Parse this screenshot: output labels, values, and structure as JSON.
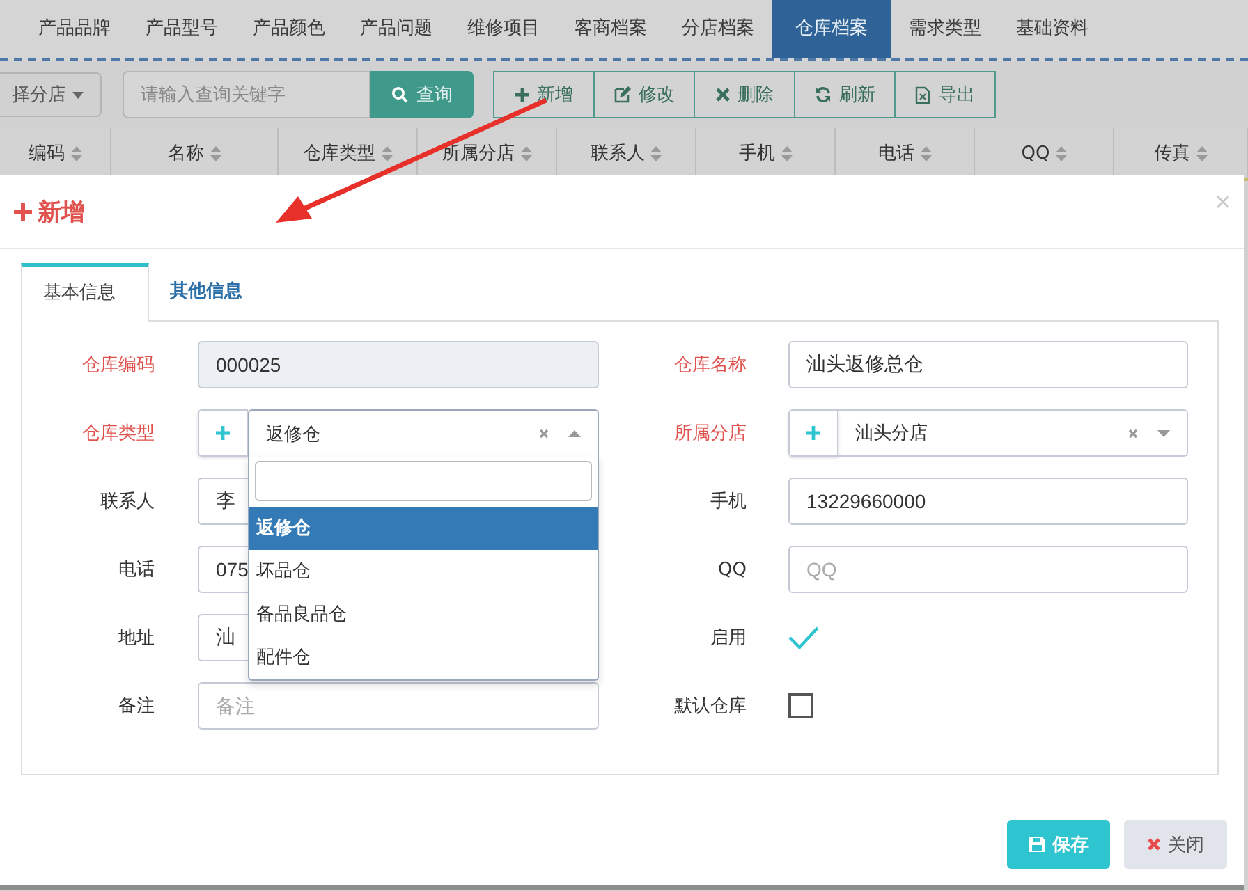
{
  "nav_tabs": [
    {
      "label": "产品品牌",
      "selected": false
    },
    {
      "label": "产品型号",
      "selected": false
    },
    {
      "label": "产品颜色",
      "selected": false
    },
    {
      "label": "产品问题",
      "selected": false
    },
    {
      "label": "维修项目",
      "selected": false
    },
    {
      "label": "客商档案",
      "selected": false
    },
    {
      "label": "分店档案",
      "selected": false
    },
    {
      "label": "仓库档案",
      "selected": true
    },
    {
      "label": "需求类型",
      "selected": false
    },
    {
      "label": "基础资料",
      "selected": false
    }
  ],
  "toolbar": {
    "branch_select": "择分店",
    "search": {
      "placeholder": "请输入查询关键字"
    },
    "search_button": "查询",
    "buttons": [
      {
        "kind": "add",
        "label": "新增"
      },
      {
        "kind": "edit",
        "label": "修改"
      },
      {
        "kind": "delete",
        "label": "删除"
      },
      {
        "kind": "refresh",
        "label": "刷新"
      },
      {
        "kind": "export",
        "label": "导出"
      }
    ]
  },
  "table": {
    "columns": [
      "编码",
      "名称",
      "仓库类型",
      "所属分店",
      "联系人",
      "手机",
      "电话",
      "QQ",
      "传真"
    ]
  },
  "modal": {
    "title": "新增",
    "tabs": [
      {
        "label": "基本信息",
        "selected": true
      },
      {
        "label": "其他信息",
        "selected": false
      }
    ],
    "fields": [
      {
        "label": "仓库编码",
        "kind": "text",
        "required": true,
        "value": "000025",
        "readonly": true
      },
      {
        "label": "仓库名称",
        "kind": "text",
        "required": true,
        "value": "汕头返修总仓",
        "readonly": false
      },
      {
        "label": "仓库类型",
        "kind": "select",
        "required": true,
        "value": "返修仓",
        "open": true,
        "options": [
          {
            "label": "返修仓",
            "selected": true
          },
          {
            "label": "坏品仓",
            "selected": false
          },
          {
            "label": "备品良品仓",
            "selected": false
          },
          {
            "label": "配件仓",
            "selected": false
          }
        ]
      },
      {
        "label": "所属分店",
        "kind": "select",
        "required": true,
        "value": "汕头分店",
        "open": false
      },
      {
        "label": "联系人",
        "kind": "text",
        "required": false,
        "value": "李",
        "readonly": false
      },
      {
        "label": "手机",
        "kind": "text",
        "required": false,
        "value": "13229660000",
        "readonly": false
      },
      {
        "label": "电话",
        "kind": "text",
        "required": false,
        "value": "075",
        "readonly": false
      },
      {
        "label": "QQ",
        "kind": "text",
        "required": false,
        "placeholder": "QQ",
        "readonly": false
      },
      {
        "label": "地址",
        "kind": "text",
        "required": false,
        "value": "汕",
        "readonly": false
      },
      {
        "label": "启用",
        "kind": "check",
        "required": false,
        "checked": true
      },
      {
        "label": "备注",
        "kind": "text",
        "required": false,
        "placeholder": "备注",
        "readonly": false
      },
      {
        "label": "默认仓库",
        "kind": "check",
        "required": false,
        "checked": false
      }
    ],
    "buttons": [
      {
        "kind": "save",
        "label": "保存"
      },
      {
        "kind": "close",
        "label": "关闭"
      }
    ]
  }
}
